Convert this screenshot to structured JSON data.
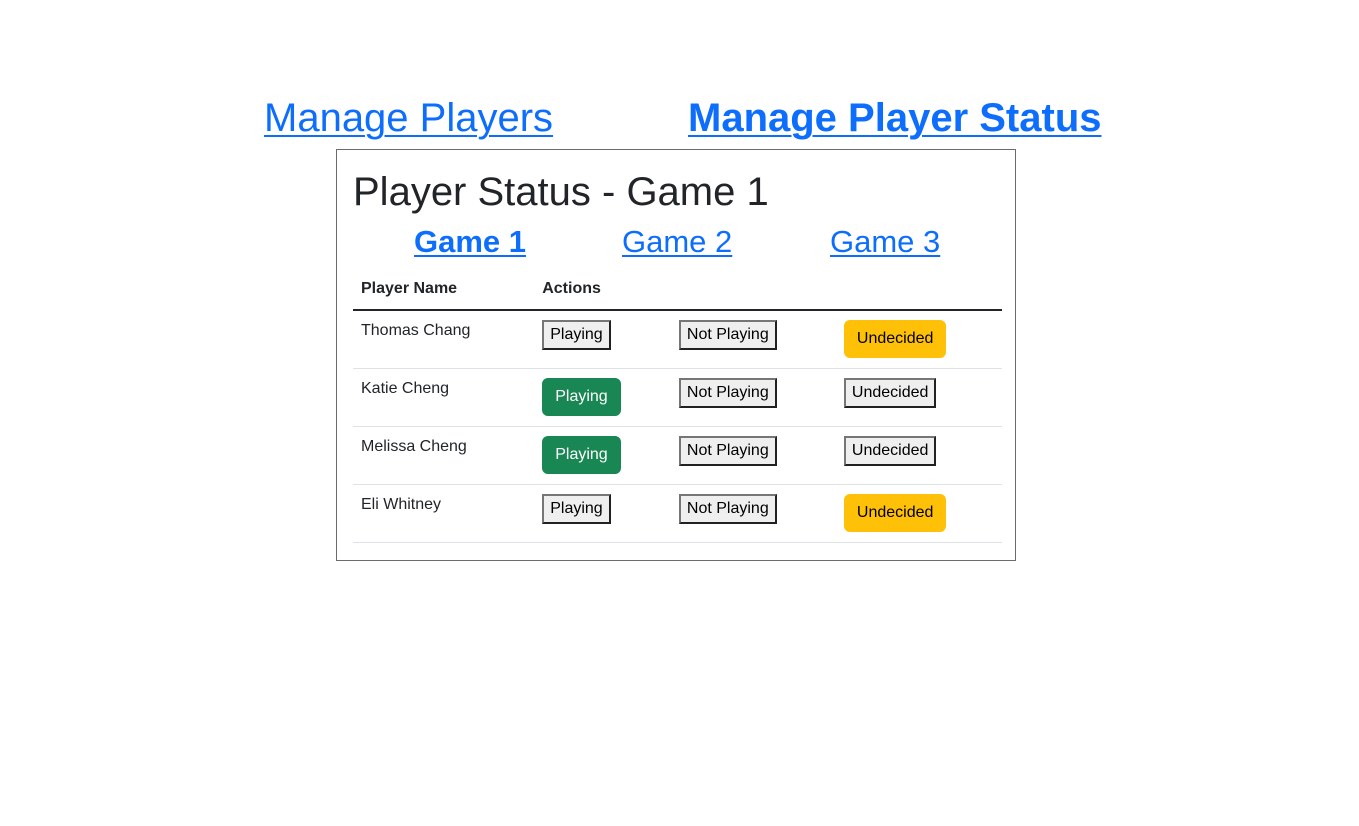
{
  "nav": {
    "manage_players": "Manage Players",
    "manage_player_status": "Manage Player Status",
    "active": "manage_player_status"
  },
  "panel": {
    "title": "Player Status - Game 1",
    "games": [
      {
        "label": "Game 1",
        "active": true
      },
      {
        "label": "Game 2",
        "active": false
      },
      {
        "label": "Game 3",
        "active": false
      }
    ],
    "table": {
      "headers": [
        "Player Name",
        "Actions"
      ],
      "button_labels": [
        "Playing",
        "Not Playing",
        "Undecided"
      ],
      "rows": [
        {
          "name": "Thomas Chang",
          "status": "Undecided"
        },
        {
          "name": "Katie Cheng",
          "status": "Playing"
        },
        {
          "name": "Melissa Cheng",
          "status": "Playing"
        },
        {
          "name": "Eli Whitney",
          "status": "Undecided"
        }
      ]
    }
  },
  "colors": {
    "link": "#0d6efd",
    "playing_active": "#198754",
    "undecided_active": "#ffc107"
  }
}
